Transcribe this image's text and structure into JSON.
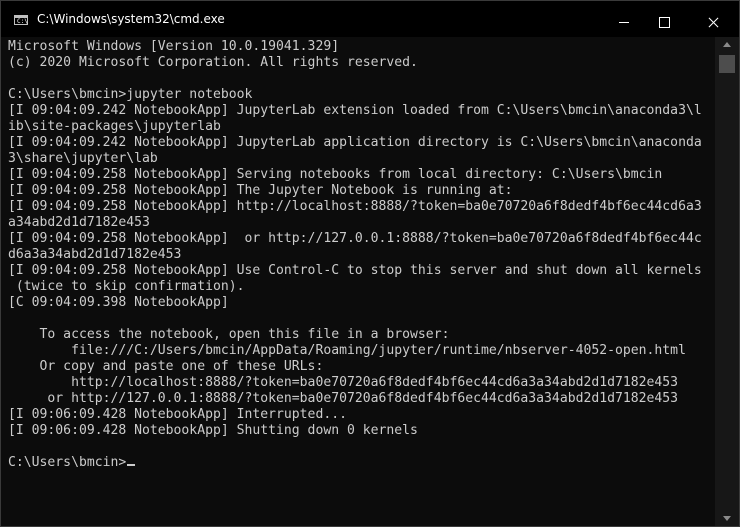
{
  "window": {
    "title": "C:\\Windows\\system32\\cmd.exe",
    "icon_glyph": "C:\\",
    "controls": {
      "minimize": "minimize-icon",
      "maximize": "maximize-icon",
      "close": "close-icon"
    }
  },
  "console": {
    "lines": [
      "Microsoft Windows [Version 10.0.19041.329]",
      "(c) 2020 Microsoft Corporation. All rights reserved.",
      "",
      "C:\\Users\\bmcin>jupyter notebook",
      "[I 09:04:09.242 NotebookApp] JupyterLab extension loaded from C:\\Users\\bmcin\\anaconda3\\l",
      "ib\\site-packages\\jupyterlab",
      "[I 09:04:09.242 NotebookApp] JupyterLab application directory is C:\\Users\\bmcin\\anaconda",
      "3\\share\\jupyter\\lab",
      "[I 09:04:09.258 NotebookApp] Serving notebooks from local directory: C:\\Users\\bmcin",
      "[I 09:04:09.258 NotebookApp] The Jupyter Notebook is running at:",
      "[I 09:04:09.258 NotebookApp] http://localhost:8888/?token=ba0e70720a6f8dedf4bf6ec44cd6a3",
      "a34abd2d1d7182e453",
      "[I 09:04:09.258 NotebookApp]  or http://127.0.0.1:8888/?token=ba0e70720a6f8dedf4bf6ec44c",
      "d6a3a34abd2d1d7182e453",
      "[I 09:04:09.258 NotebookApp] Use Control-C to stop this server and shut down all kernels",
      " (twice to skip confirmation).",
      "[C 09:04:09.398 NotebookApp]",
      "",
      "    To access the notebook, open this file in a browser:",
      "        file:///C:/Users/bmcin/AppData/Roaming/jupyter/runtime/nbserver-4052-open.html",
      "    Or copy and paste one of these URLs:",
      "        http://localhost:8888/?token=ba0e70720a6f8dedf4bf6ec44cd6a3a34abd2d1d7182e453",
      "     or http://127.0.0.1:8888/?token=ba0e70720a6f8dedf4bf6ec44cd6a3a34abd2d1d7182e453",
      "[I 09:06:09.428 NotebookApp] Interrupted...",
      "[I 09:06:09.428 NotebookApp] Shutting down 0 kernels",
      ""
    ],
    "prompt": "C:\\Users\\bmcin>"
  },
  "colors": {
    "console_background": "#0c0c0c",
    "console_text": "#cccccc",
    "titlebar_background": "#000000"
  }
}
